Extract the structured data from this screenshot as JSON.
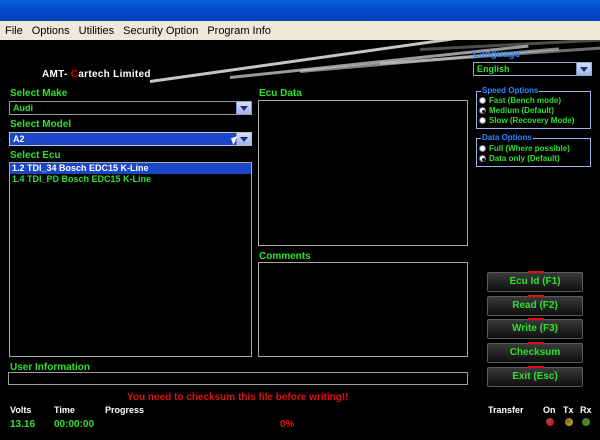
{
  "menu": [
    "File",
    "Options",
    "Utilities",
    "Security Option",
    "Program Info"
  ],
  "brand": {
    "prefix": "AMT-",
    "accent": "C",
    "rest": "artech Limited"
  },
  "language": {
    "label": "Language",
    "value": "English"
  },
  "make": {
    "label": "Select Make",
    "value": "Audi"
  },
  "model": {
    "label": "Select Model",
    "value": "A2"
  },
  "ecu": {
    "label": "Select Ecu",
    "items": [
      "1.2 TDI_34 Bosch EDC15 K-Line",
      "1.4 TDI_PD Bosch EDC15 K-Line"
    ],
    "selected_index": 0
  },
  "ecu_data": {
    "label": "Ecu Data"
  },
  "comments": {
    "label": "Comments"
  },
  "speed_options": {
    "title": "Speed Options",
    "options": [
      "Fast (Bench mode)",
      "Medium (Default)",
      "Slow (Recovery Mode)"
    ],
    "selected_index": 1
  },
  "data_options": {
    "title": "Data Options",
    "options": [
      "Full (Where possible)",
      "Data only (Default)"
    ],
    "selected_index": 1
  },
  "buttons": {
    "ecu_id": "Ecu Id   (F1)",
    "read": "Read   (F2)",
    "write": "Write   (F3)",
    "checksum": "Checksum",
    "exit": "Exit   (Esc)"
  },
  "user_info": {
    "label": "User Information"
  },
  "message": "You need to checksum this file before writing!!",
  "status": {
    "volts_label": "Volts",
    "volts_value": "13.16",
    "time_label": "Time",
    "time_value": "00:00:00",
    "progress_label": "Progress",
    "progress_value": "0%",
    "transfer_label": "Transfer",
    "on_label": "On",
    "tx_label": "Tx",
    "rx_label": "Rx"
  },
  "colors": {
    "label_green": "#2ee02e",
    "label_blue": "#2f88ff",
    "alert_red": "#e01010",
    "selection_blue": "#1b46c8"
  },
  "leds": {
    "on": "#e01010",
    "tx": "#b8a000",
    "rx": "#3a9a00"
  }
}
